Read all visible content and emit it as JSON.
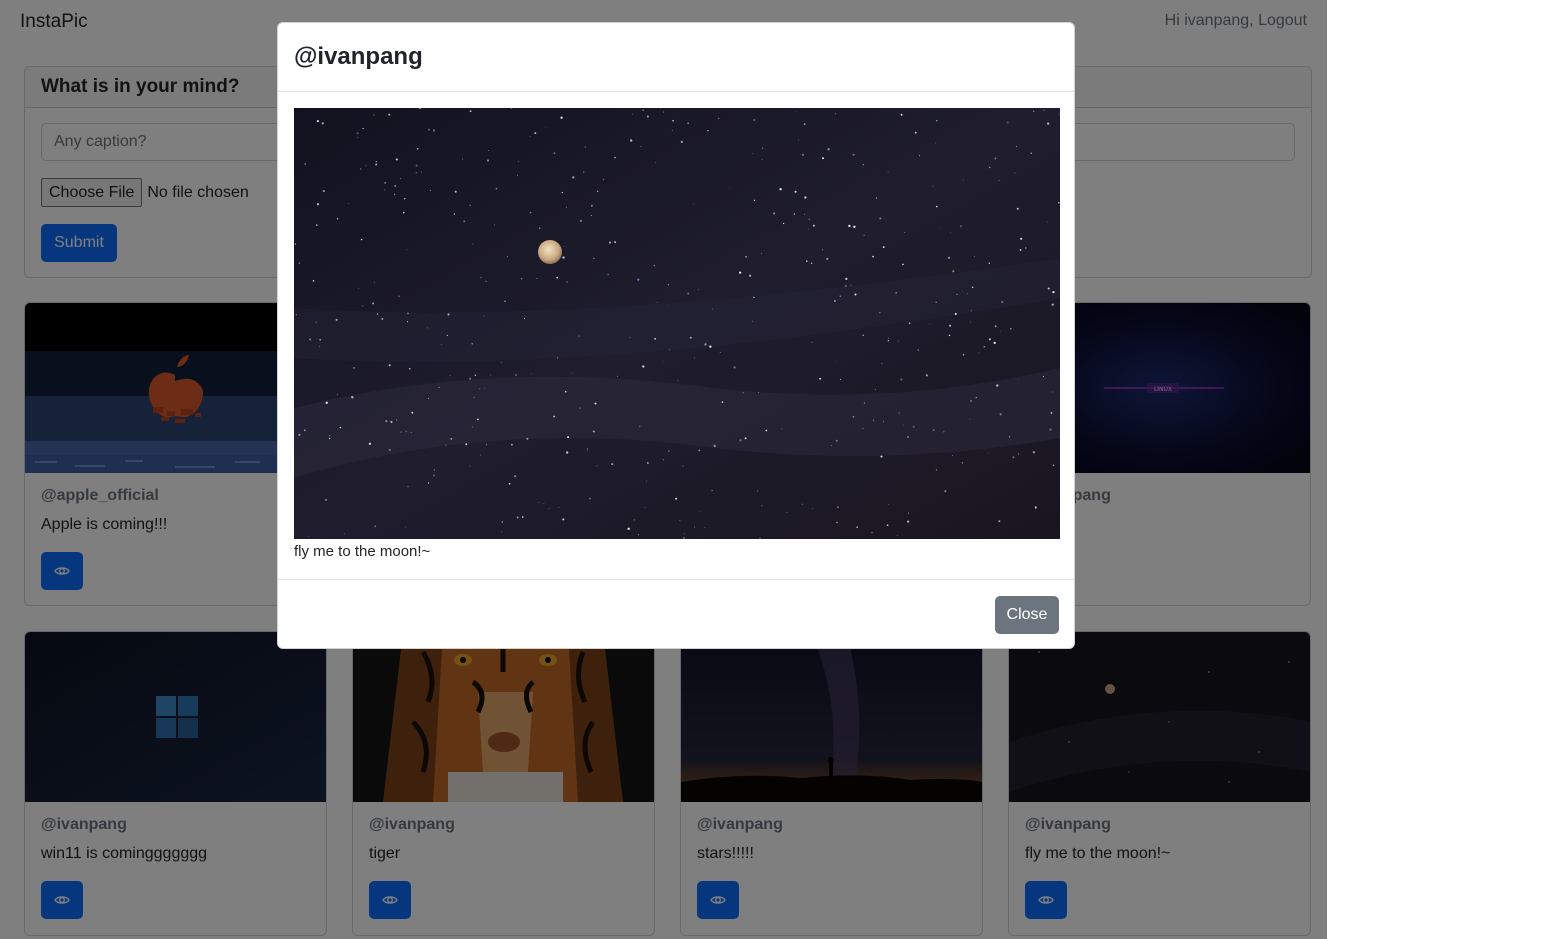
{
  "navbar": {
    "brand": "InstaPic",
    "greeting": "Hi ivanpang,",
    "logout": "Logout"
  },
  "compose": {
    "title": "What is in your mind?",
    "caption_placeholder": "Any caption?",
    "choose_file_label": "Choose File",
    "file_status": "No file chosen",
    "submit_label": "Submit"
  },
  "posts": [
    {
      "author": "@apple_official",
      "caption": "Apple is coming!!!",
      "image": "apple-logo-image"
    },
    {
      "author": "@ivanpang",
      "caption": "",
      "image": "linux-image"
    },
    {
      "author": "@ivanpang",
      "caption": "win11 is cominggggggg",
      "image": "windows-logo-image"
    },
    {
      "author": "@ivanpang",
      "caption": "tiger",
      "image": "tiger-image"
    },
    {
      "author": "@ivanpang",
      "caption": "stars!!!!!",
      "image": "milky-way-image"
    },
    {
      "author": "@ivanpang",
      "caption": "fly me to the moon!~",
      "image": "moon-night-sky-image"
    }
  ],
  "modal": {
    "title": "@ivanpang",
    "caption": "fly me to the moon!~",
    "image": "moon-night-sky-image",
    "close_label": "Close"
  },
  "colors": {
    "primary": "#0d6efd",
    "secondary": "#6c757d",
    "backdrop": "rgba(0,0,0,0.5)"
  },
  "icons": {
    "view": "eye-icon"
  }
}
